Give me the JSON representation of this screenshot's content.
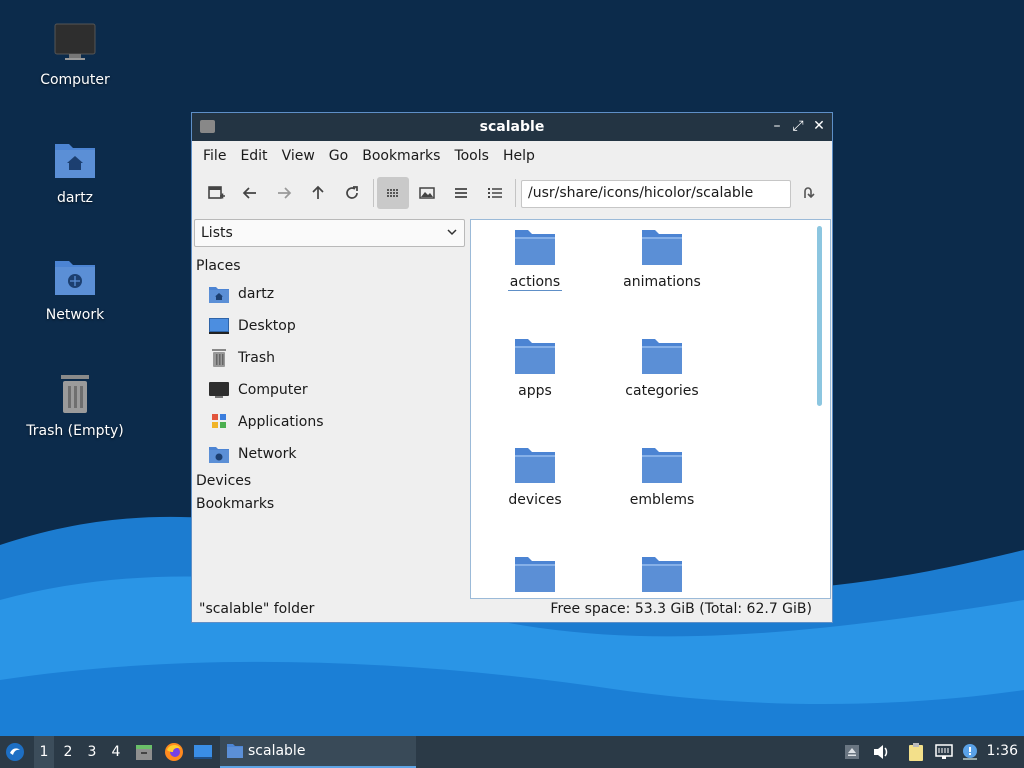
{
  "desktop": {
    "icons": [
      {
        "label": "Computer",
        "icon": "computer-icon"
      },
      {
        "label": "dartz",
        "icon": "home-folder-icon"
      },
      {
        "label": "Network",
        "icon": "network-folder-icon"
      },
      {
        "label": "Trash (Empty)",
        "icon": "trash-icon"
      }
    ]
  },
  "window": {
    "title": "scalable",
    "menu": [
      "File",
      "Edit",
      "View",
      "Go",
      "Bookmarks",
      "Tools",
      "Help"
    ],
    "path": "/usr/share/icons/hicolor/scalable",
    "sidebar": {
      "mode": "Lists",
      "places_heading": "Places",
      "places": [
        {
          "label": "dartz",
          "icon": "home-folder-icon"
        },
        {
          "label": "Desktop",
          "icon": "desktop-icon"
        },
        {
          "label": "Trash",
          "icon": "trash-icon"
        },
        {
          "label": "Computer",
          "icon": "computer-icon"
        },
        {
          "label": "Applications",
          "icon": "applications-icon"
        },
        {
          "label": "Network",
          "icon": "network-folder-icon"
        }
      ],
      "devices_heading": "Devices",
      "bookmarks_heading": "Bookmarks"
    },
    "files": [
      {
        "name": "actions",
        "selected": true
      },
      {
        "name": "animations",
        "selected": false
      },
      {
        "name": "apps",
        "selected": false
      },
      {
        "name": "categories",
        "selected": false
      },
      {
        "name": "devices",
        "selected": false
      },
      {
        "name": "emblems",
        "selected": false
      },
      {
        "name": "",
        "selected": false
      },
      {
        "name": "",
        "selected": false
      }
    ],
    "status_left": "\"scalable\" folder",
    "status_right": "Free space: 53.3 GiB (Total: 62.7 GiB)"
  },
  "panel": {
    "workspaces": [
      "1",
      "2",
      "3",
      "4"
    ],
    "active_workspace": "1",
    "task_label": "scalable",
    "clock": "1:36"
  },
  "colors": {
    "folder": "#5b8fd6",
    "titlebar": "#233443",
    "panel": "#2b3a47",
    "wave": "#1e88d8"
  }
}
